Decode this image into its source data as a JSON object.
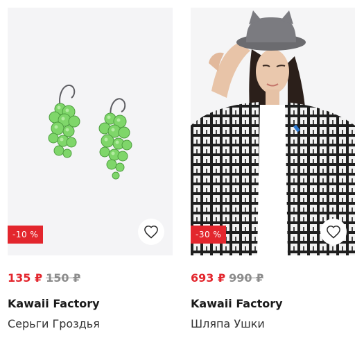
{
  "products": [
    {
      "image": "green-grape-earrings-photo",
      "discount": "-10 %",
      "price_new": "135 ₽",
      "price_old": "150 ₽",
      "brand": "Kawaii Factory",
      "name": "Серьги Гроздья"
    },
    {
      "image": "woman-gray-cat-ear-hat-photo",
      "discount": "-30 %",
      "price_new": "693 ₽",
      "price_old": "990 ₽",
      "brand": "Kawaii Factory",
      "name": "Шляпа Ушки"
    }
  ],
  "icons": {
    "favorite": "heart-outline-icon"
  },
  "colors": {
    "accent": "#e3262d",
    "old_price": "#8c8c8c",
    "text": "#1a1a1a"
  }
}
